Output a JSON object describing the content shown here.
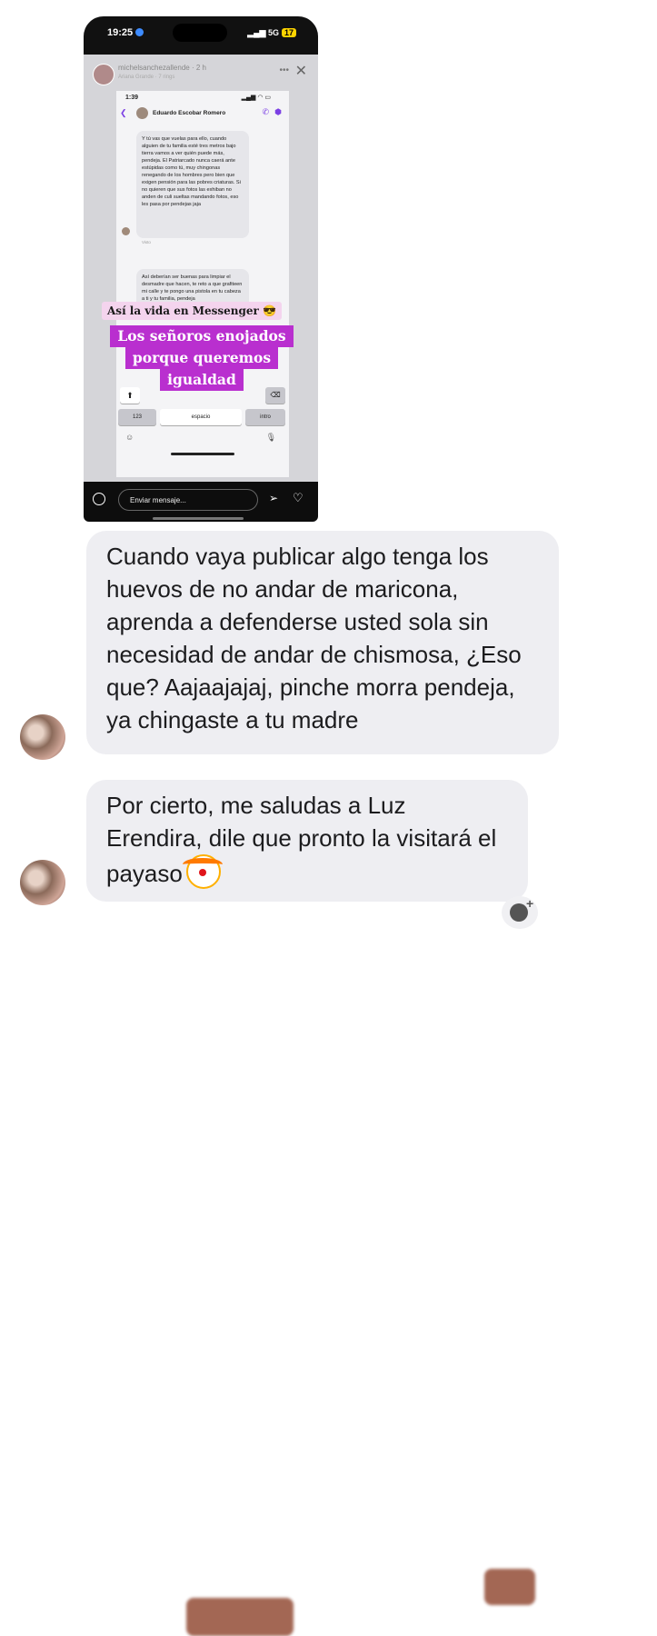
{
  "story": {
    "status_time": "19:25",
    "status_network": "5G",
    "status_battery": "17",
    "poster_name": "michelsanchezallende",
    "poster_age": "2 h",
    "poster_subtitle": "Ariana Grande · 7 rings",
    "inner": {
      "time": "1:39",
      "contact_name": "Eduardo Escobar Romero",
      "message1": "Y tú vas que vuelas para ello, cuando alguien de tu familia esté tres metros bajo tierra vamos a ver quién puede más, pendeja. El Patriarcado nunca caerá ante estúpidas como tú, muy chingonas renegando de los hombres pero bien que exigen pensión para las pobres criaturas. Si no quieren que sus fotos las exhiban no anden de culi sueltas mandando fotos, eso les pasa por pendejas jaja",
      "seen_label": "Visto",
      "message2": "Así deberían ser buenas para limpiar el desmadre que hacen, te reto a que grafiteen mi calle y te pongo una pistola en tu cabeza a ti y tu familia, pendeja",
      "keyboard": {
        "shift": "⬆",
        "delete": "⌫",
        "numbers": "123",
        "space": "espacio",
        "enter": "intro"
      }
    },
    "sticker_1": "Así la vida en Messenger 😎",
    "sticker_2_lines": [
      "Los señoros enojados",
      "porque queremos",
      "igualdad"
    ],
    "reply_placeholder": "Enviar mensaje..."
  },
  "messages": [
    {
      "text": "Cuando vaya publicar algo tenga los huevos de no andar de maricona, aprenda a defenderse usted sola sin necesidad de andar de chismosa, ¿Eso que? Aajaajajaj, pinche morra pendeja, ya chingaste a tu madre"
    },
    {
      "text": "Por cierto, me saludas a Luz Erendira, dile que pronto la visitará el payaso"
    }
  ],
  "icons": {
    "clown": "clown-emoji",
    "react": "add-reaction-icon"
  }
}
